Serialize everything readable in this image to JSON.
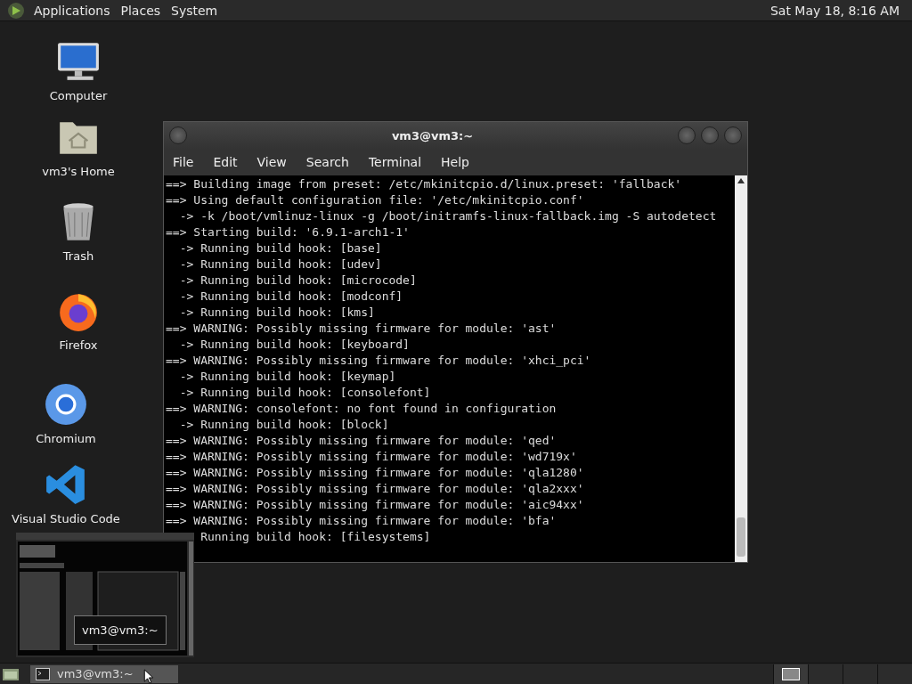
{
  "top_panel": {
    "menus": [
      "Applications",
      "Places",
      "System"
    ],
    "clock": "Sat May 18,  8:16 AM"
  },
  "desktop_icons": [
    {
      "kind": "computer",
      "label": "Computer"
    },
    {
      "kind": "home",
      "label": "vm3's Home"
    },
    {
      "kind": "trash",
      "label": "Trash"
    },
    {
      "kind": "firefox",
      "label": "Firefox"
    },
    {
      "kind": "chromium",
      "label": "Chromium"
    },
    {
      "kind": "vscode",
      "label": "Visual Studio Code"
    }
  ],
  "terminal": {
    "title": "vm3@vm3:~",
    "menus": [
      "File",
      "Edit",
      "View",
      "Search",
      "Terminal",
      "Help"
    ],
    "lines": [
      "==> Building image from preset: /etc/mkinitcpio.d/linux.preset: 'fallback'",
      "==> Using default configuration file: '/etc/mkinitcpio.conf'",
      "  -> -k /boot/vmlinuz-linux -g /boot/initramfs-linux-fallback.img -S autodetect",
      "==> Starting build: '6.9.1-arch1-1'",
      "  -> Running build hook: [base]",
      "  -> Running build hook: [udev]",
      "  -> Running build hook: [microcode]",
      "  -> Running build hook: [modconf]",
      "  -> Running build hook: [kms]",
      "==> WARNING: Possibly missing firmware for module: 'ast'",
      "  -> Running build hook: [keyboard]",
      "==> WARNING: Possibly missing firmware for module: 'xhci_pci'",
      "  -> Running build hook: [keymap]",
      "  -> Running build hook: [consolefont]",
      "==> WARNING: consolefont: no font found in configuration",
      "  -> Running build hook: [block]",
      "==> WARNING: Possibly missing firmware for module: 'qed'",
      "==> WARNING: Possibly missing firmware for module: 'wd719x'",
      "==> WARNING: Possibly missing firmware for module: 'qla1280'",
      "==> WARNING: Possibly missing firmware for module: 'qla2xxx'",
      "==> WARNING: Possibly missing firmware for module: 'aic94xx'",
      "==> WARNING: Possibly missing firmware for module: 'bfa'",
      "     Running build hook: [filesystems]"
    ]
  },
  "window_preview": {
    "kind": "picture",
    "tooltip": "vm3@vm3:~"
  },
  "taskbar": {
    "tasks": [
      {
        "label": "vm3@vm3:~",
        "selected": true
      }
    ],
    "workspaces": [
      {
        "selected": true
      },
      {
        "selected": false
      },
      {
        "selected": false
      },
      {
        "selected": false
      }
    ]
  }
}
